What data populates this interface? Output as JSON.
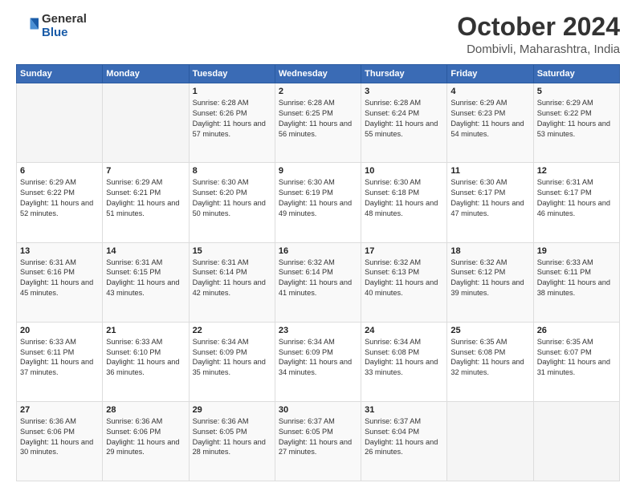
{
  "logo": {
    "general": "General",
    "blue": "Blue"
  },
  "header": {
    "title": "October 2024",
    "subtitle": "Dombivli, Maharashtra, India"
  },
  "weekdays": [
    "Sunday",
    "Monday",
    "Tuesday",
    "Wednesday",
    "Thursday",
    "Friday",
    "Saturday"
  ],
  "weeks": [
    [
      {
        "day": "",
        "info": ""
      },
      {
        "day": "",
        "info": ""
      },
      {
        "day": "1",
        "info": "Sunrise: 6:28 AM\nSunset: 6:26 PM\nDaylight: 11 hours and 57 minutes."
      },
      {
        "day": "2",
        "info": "Sunrise: 6:28 AM\nSunset: 6:25 PM\nDaylight: 11 hours and 56 minutes."
      },
      {
        "day": "3",
        "info": "Sunrise: 6:28 AM\nSunset: 6:24 PM\nDaylight: 11 hours and 55 minutes."
      },
      {
        "day": "4",
        "info": "Sunrise: 6:29 AM\nSunset: 6:23 PM\nDaylight: 11 hours and 54 minutes."
      },
      {
        "day": "5",
        "info": "Sunrise: 6:29 AM\nSunset: 6:22 PM\nDaylight: 11 hours and 53 minutes."
      }
    ],
    [
      {
        "day": "6",
        "info": "Sunrise: 6:29 AM\nSunset: 6:22 PM\nDaylight: 11 hours and 52 minutes."
      },
      {
        "day": "7",
        "info": "Sunrise: 6:29 AM\nSunset: 6:21 PM\nDaylight: 11 hours and 51 minutes."
      },
      {
        "day": "8",
        "info": "Sunrise: 6:30 AM\nSunset: 6:20 PM\nDaylight: 11 hours and 50 minutes."
      },
      {
        "day": "9",
        "info": "Sunrise: 6:30 AM\nSunset: 6:19 PM\nDaylight: 11 hours and 49 minutes."
      },
      {
        "day": "10",
        "info": "Sunrise: 6:30 AM\nSunset: 6:18 PM\nDaylight: 11 hours and 48 minutes."
      },
      {
        "day": "11",
        "info": "Sunrise: 6:30 AM\nSunset: 6:17 PM\nDaylight: 11 hours and 47 minutes."
      },
      {
        "day": "12",
        "info": "Sunrise: 6:31 AM\nSunset: 6:17 PM\nDaylight: 11 hours and 46 minutes."
      }
    ],
    [
      {
        "day": "13",
        "info": "Sunrise: 6:31 AM\nSunset: 6:16 PM\nDaylight: 11 hours and 45 minutes."
      },
      {
        "day": "14",
        "info": "Sunrise: 6:31 AM\nSunset: 6:15 PM\nDaylight: 11 hours and 43 minutes."
      },
      {
        "day": "15",
        "info": "Sunrise: 6:31 AM\nSunset: 6:14 PM\nDaylight: 11 hours and 42 minutes."
      },
      {
        "day": "16",
        "info": "Sunrise: 6:32 AM\nSunset: 6:14 PM\nDaylight: 11 hours and 41 minutes."
      },
      {
        "day": "17",
        "info": "Sunrise: 6:32 AM\nSunset: 6:13 PM\nDaylight: 11 hours and 40 minutes."
      },
      {
        "day": "18",
        "info": "Sunrise: 6:32 AM\nSunset: 6:12 PM\nDaylight: 11 hours and 39 minutes."
      },
      {
        "day": "19",
        "info": "Sunrise: 6:33 AM\nSunset: 6:11 PM\nDaylight: 11 hours and 38 minutes."
      }
    ],
    [
      {
        "day": "20",
        "info": "Sunrise: 6:33 AM\nSunset: 6:11 PM\nDaylight: 11 hours and 37 minutes."
      },
      {
        "day": "21",
        "info": "Sunrise: 6:33 AM\nSunset: 6:10 PM\nDaylight: 11 hours and 36 minutes."
      },
      {
        "day": "22",
        "info": "Sunrise: 6:34 AM\nSunset: 6:09 PM\nDaylight: 11 hours and 35 minutes."
      },
      {
        "day": "23",
        "info": "Sunrise: 6:34 AM\nSunset: 6:09 PM\nDaylight: 11 hours and 34 minutes."
      },
      {
        "day": "24",
        "info": "Sunrise: 6:34 AM\nSunset: 6:08 PM\nDaylight: 11 hours and 33 minutes."
      },
      {
        "day": "25",
        "info": "Sunrise: 6:35 AM\nSunset: 6:08 PM\nDaylight: 11 hours and 32 minutes."
      },
      {
        "day": "26",
        "info": "Sunrise: 6:35 AM\nSunset: 6:07 PM\nDaylight: 11 hours and 31 minutes."
      }
    ],
    [
      {
        "day": "27",
        "info": "Sunrise: 6:36 AM\nSunset: 6:06 PM\nDaylight: 11 hours and 30 minutes."
      },
      {
        "day": "28",
        "info": "Sunrise: 6:36 AM\nSunset: 6:06 PM\nDaylight: 11 hours and 29 minutes."
      },
      {
        "day": "29",
        "info": "Sunrise: 6:36 AM\nSunset: 6:05 PM\nDaylight: 11 hours and 28 minutes."
      },
      {
        "day": "30",
        "info": "Sunrise: 6:37 AM\nSunset: 6:05 PM\nDaylight: 11 hours and 27 minutes."
      },
      {
        "day": "31",
        "info": "Sunrise: 6:37 AM\nSunset: 6:04 PM\nDaylight: 11 hours and 26 minutes."
      },
      {
        "day": "",
        "info": ""
      },
      {
        "day": "",
        "info": ""
      }
    ]
  ]
}
